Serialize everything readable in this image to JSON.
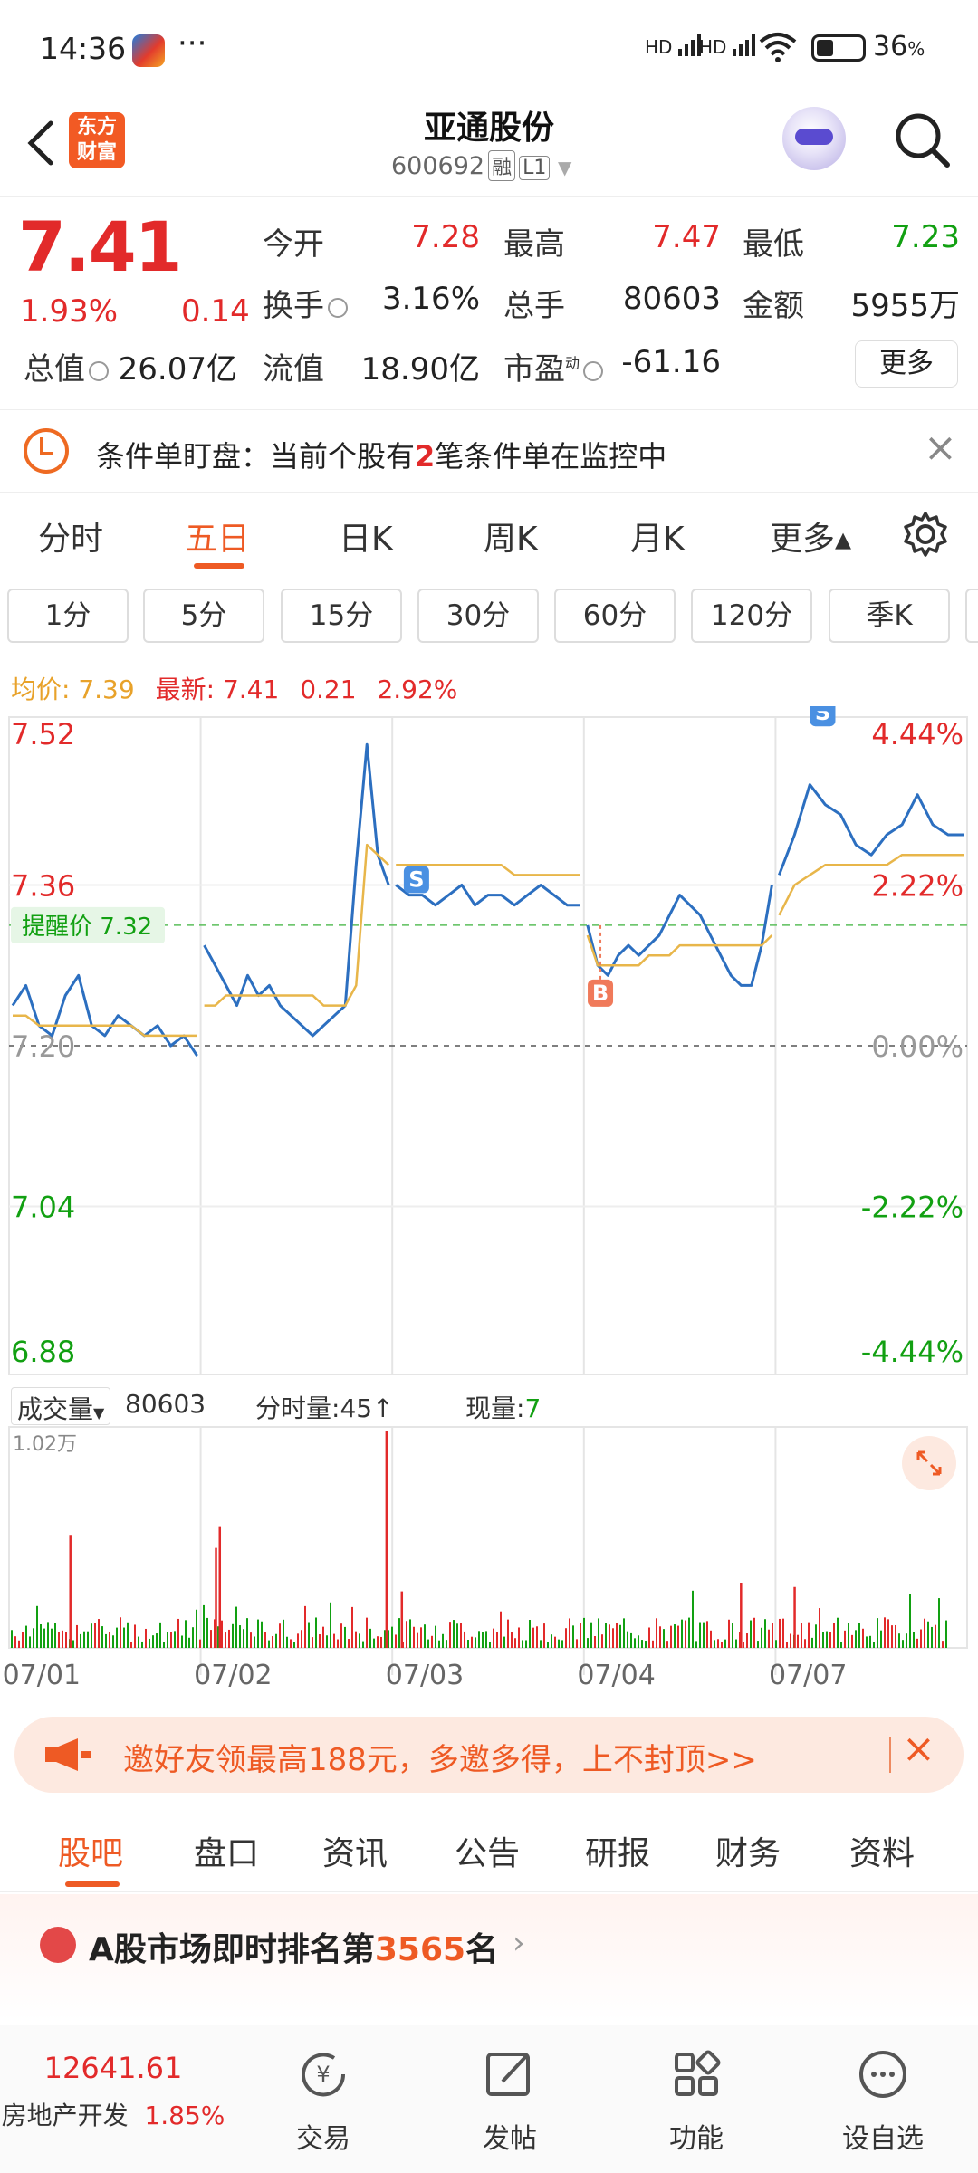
{
  "status_bar": {
    "time": "14:36",
    "dots": "···",
    "signal1": "HD",
    "signal2": "HD",
    "battery": "36"
  },
  "header": {
    "logo_line1": "东方",
    "logo_line2": "财富",
    "stock_name": "亚通股份",
    "stock_code": "600692",
    "tag_margin": "融",
    "tag_level": "L1"
  },
  "quote": {
    "price": "7.41",
    "change_pct": "1.93%",
    "change": "0.14",
    "open_label": "今开",
    "open": "7.28",
    "high_label": "最高",
    "high": "7.47",
    "low_label": "最低",
    "low": "7.23",
    "turnover_label": "换手",
    "turnover": "3.16%",
    "volume_label": "总手",
    "volume": "80603",
    "amount_label": "金额",
    "amount": "5955万",
    "mktcap_label": "总值",
    "mktcap": "26.07亿",
    "float_label": "流值",
    "float": "18.90亿",
    "pe_label": "市盈",
    "pe_sup": "动",
    "pe": "-61.16",
    "more": "更多"
  },
  "alert": {
    "prefix": "条件单盯盘：当前个股有",
    "count": "2",
    "suffix": "笔条件单在监控中"
  },
  "tabs": [
    "分时",
    "五日",
    "日K",
    "周K",
    "月K",
    "更多▴"
  ],
  "active_tab": "五日",
  "ranges": [
    "1分",
    "5分",
    "15分",
    "30分",
    "60分",
    "120分",
    "季K"
  ],
  "avg_line": {
    "avg_label": "均价:",
    "avg_value": "7.39",
    "latest_label": "最新:",
    "latest_value": "7.41",
    "change": "0.21",
    "pct": "2.92%"
  },
  "chart_data": {
    "type": "line",
    "title": "",
    "y_left_labels": [
      "7.52",
      "7.36",
      "7.20",
      "7.04",
      "6.88"
    ],
    "y_right_labels": [
      "4.44%",
      "2.22%",
      "0.00%",
      "-2.22%",
      "-4.44%"
    ],
    "ylim": [
      6.88,
      7.52
    ],
    "base_price": 7.2,
    "reminder_label": "提醒价",
    "reminder_price": "7.32",
    "x_labels": [
      "07/01",
      "07/02",
      "07/03",
      "07/04",
      "07/07"
    ],
    "markers": [
      {
        "label": "S",
        "day": 2,
        "price": 7.37
      },
      {
        "label": "B",
        "day": 3,
        "price": 7.32
      },
      {
        "label": "S",
        "day": 4,
        "price": 7.5
      },
      {
        "label": "S",
        "day": 4,
        "price": 7.49
      }
    ],
    "series": [
      {
        "name": "价格",
        "color": "#2c6fc0",
        "days": [
          [
            7.24,
            7.26,
            7.22,
            7.21,
            7.25,
            7.27,
            7.22,
            7.21,
            7.23,
            7.22,
            7.21,
            7.22,
            7.2,
            7.21,
            7.19
          ],
          [
            7.3,
            7.28,
            7.26,
            7.24,
            7.27,
            7.25,
            7.26,
            7.24,
            7.23,
            7.22,
            7.21,
            7.22,
            7.23,
            7.24,
            7.38,
            7.5,
            7.39,
            7.36
          ],
          [
            7.36,
            7.35,
            7.35,
            7.34,
            7.35,
            7.36,
            7.34,
            7.35,
            7.35,
            7.34,
            7.35,
            7.36,
            7.35,
            7.34,
            7.34
          ],
          [
            7.32,
            7.28,
            7.27,
            7.29,
            7.3,
            7.29,
            7.3,
            7.31,
            7.33,
            7.35,
            7.34,
            7.33,
            7.31,
            7.29,
            7.27,
            7.26,
            7.26,
            7.3,
            7.36
          ],
          [
            7.37,
            7.41,
            7.46,
            7.44,
            7.43,
            7.4,
            7.39,
            7.41,
            7.42,
            7.45,
            7.42,
            7.41,
            7.41
          ]
        ]
      },
      {
        "name": "均价",
        "color": "#e8b64a",
        "days": [
          [
            7.23,
            7.23,
            7.22,
            7.22,
            7.22,
            7.22,
            7.22,
            7.22,
            7.22,
            7.22,
            7.21,
            7.21,
            7.21,
            7.21,
            7.21
          ],
          [
            7.24,
            7.24,
            7.25,
            7.25,
            7.25,
            7.25,
            7.25,
            7.25,
            7.25,
            7.25,
            7.25,
            7.24,
            7.24,
            7.24,
            7.26,
            7.4,
            7.39,
            7.38
          ],
          [
            7.38,
            7.38,
            7.38,
            7.38,
            7.38,
            7.38,
            7.38,
            7.38,
            7.38,
            7.37,
            7.37,
            7.37,
            7.37,
            7.37,
            7.37
          ],
          [
            7.31,
            7.28,
            7.28,
            7.28,
            7.28,
            7.28,
            7.29,
            7.29,
            7.29,
            7.3,
            7.3,
            7.3,
            7.3,
            7.3,
            7.3,
            7.3,
            7.3,
            7.3,
            7.31
          ],
          [
            7.33,
            7.36,
            7.37,
            7.38,
            7.38,
            7.38,
            7.38,
            7.38,
            7.39,
            7.39,
            7.39,
            7.39,
            7.39
          ]
        ]
      }
    ]
  },
  "volume": {
    "label": "成交量",
    "total": "80603",
    "fenshi_label": "分时量:",
    "fenshi_value": "45",
    "current_label": "现量:",
    "current_value": "7",
    "max_label": "1.02万",
    "spikes": [
      {
        "day": 0,
        "pos": 0.32,
        "v": 0.52
      },
      {
        "day": 1,
        "pos": 0.08,
        "v": 0.46
      },
      {
        "day": 1,
        "pos": 0.1,
        "v": 0.56
      },
      {
        "day": 1,
        "pos": 0.97,
        "v": 1.0
      },
      {
        "day": 2,
        "pos": 0.05,
        "v": 0.26
      },
      {
        "day": 3,
        "pos": 0.82,
        "v": 0.3
      },
      {
        "day": 4,
        "pos": 0.1,
        "v": 0.28
      }
    ]
  },
  "banner": {
    "text": "邀好友领最高188元，多邀多得，上不封顶>>"
  },
  "subtabs": [
    "股吧",
    "盘口",
    "资讯",
    "公告",
    "研报",
    "财务",
    "资料"
  ],
  "rank": {
    "prefix": "A股市场即时排名第",
    "number": "3565",
    "suffix": "名"
  },
  "bottom_nav": {
    "index_value": "12641.61",
    "index_name": "房地产开发",
    "index_pct": "1.85%",
    "items": [
      "交易",
      "发帖",
      "功能",
      "设自选"
    ]
  },
  "colors": {
    "accent": "#ee5a24",
    "up": "#e22a2a",
    "down": "#12a012",
    "price_line": "#2c6fc0",
    "avg_line": "#e8b64a"
  }
}
